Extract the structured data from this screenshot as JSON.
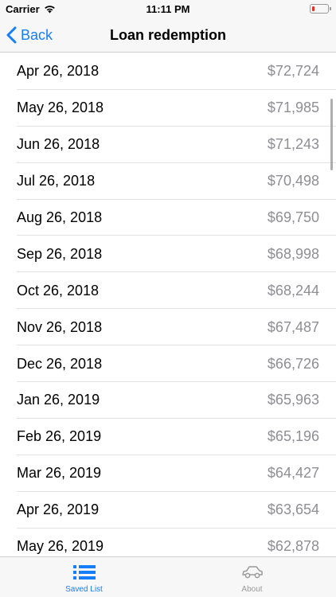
{
  "status_bar": {
    "carrier": "Carrier",
    "time": "11:11 PM"
  },
  "nav": {
    "back_label": "Back",
    "title": "Loan redemption"
  },
  "rows": [
    {
      "date": "Apr 26, 2018",
      "amount": "$72,724"
    },
    {
      "date": "May 26, 2018",
      "amount": "$71,985"
    },
    {
      "date": "Jun 26, 2018",
      "amount": "$71,243"
    },
    {
      "date": "Jul 26, 2018",
      "amount": "$70,498"
    },
    {
      "date": "Aug 26, 2018",
      "amount": "$69,750"
    },
    {
      "date": "Sep 26, 2018",
      "amount": "$68,998"
    },
    {
      "date": "Oct 26, 2018",
      "amount": "$68,244"
    },
    {
      "date": "Nov 26, 2018",
      "amount": "$67,487"
    },
    {
      "date": "Dec 26, 2018",
      "amount": "$66,726"
    },
    {
      "date": "Jan 26, 2019",
      "amount": "$65,963"
    },
    {
      "date": "Feb 26, 2019",
      "amount": "$65,196"
    },
    {
      "date": "Mar 26, 2019",
      "amount": "$64,427"
    },
    {
      "date": "Apr 26, 2019",
      "amount": "$63,654"
    },
    {
      "date": "May 26, 2019",
      "amount": "$62,878"
    }
  ],
  "tabs": [
    {
      "label": "Saved List",
      "icon": "list-icon",
      "active": true
    },
    {
      "label": "About",
      "icon": "car-icon",
      "active": false
    }
  ],
  "colors": {
    "accent": "#157efb",
    "secondary_text": "#8e8e93",
    "battery_low": "#e0312b"
  }
}
